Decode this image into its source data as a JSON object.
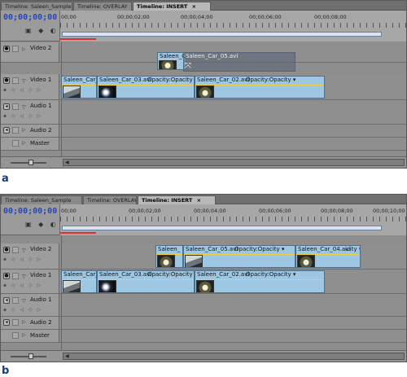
{
  "panels": [
    {
      "label": "a",
      "tabs": [
        "Timeline: Saleen_Sample",
        "Timeline: OVERLAY",
        "Timeline: INSERT"
      ],
      "active_tab_close": "×",
      "timecode": "00;00;00;00",
      "ruler_labels": [
        "00;00",
        "00;00;02;00",
        "00;00;04;00",
        "00;00;06;00",
        "00;00;08;00"
      ],
      "tracks": [
        {
          "name": "Video 2",
          "clips": []
        },
        {
          "name": "Video 1",
          "clips": [
            {
              "name": "Saleen_Car_0",
              "opacity": ""
            },
            {
              "name": "Saleen_Car_03.avi",
              "opacity": "Opacity:Opacity ▾"
            },
            {
              "name": "Saleen_Car_02.avi",
              "opacity": "Opacity:Opacity ▾"
            }
          ]
        },
        {
          "name": "Audio 1"
        },
        {
          "name": "Audio 2"
        },
        {
          "name": "Master"
        }
      ],
      "drag_clip": {
        "name": "Saleen_Ca",
        "ghost_name": "Saleen_Car_05.avi"
      }
    },
    {
      "label": "b",
      "tabs": [
        "Timeline: Saleen_Sample",
        "Timeline: OVERLAY",
        "Timeline: INSERT"
      ],
      "active_tab_close": "×",
      "timecode": "00;00;00;00",
      "ruler_labels": [
        "00;00",
        "00;00;02;00",
        "00;00;04;00",
        "00;00;06;00",
        "00;00;08;00",
        "00;00;10;00"
      ],
      "tracks": [
        {
          "name": "Video 2",
          "clips": [
            {
              "name": "Saleen_",
              "opacity": ""
            },
            {
              "name": "Saleen_Car_05.avi",
              "opacity": "Opacity:Opacity ▾"
            },
            {
              "name": "Saleen_Car_04.avi",
              "opacity": "icity ▾"
            }
          ]
        },
        {
          "name": "Video 1",
          "clips": [
            {
              "name": "Saleen_Car_0",
              "opacity": ""
            },
            {
              "name": "Saleen_Car_03.avi",
              "opacity": "Opacity:Opacity ▾"
            },
            {
              "name": "Saleen_Car_02.avi",
              "opacity": "Opacity:Opacity ▾"
            }
          ]
        },
        {
          "name": "Audio 1"
        },
        {
          "name": "Audio 2"
        },
        {
          "name": "Master"
        }
      ]
    }
  ],
  "colors": {
    "panel_bg": "#8d8d8d",
    "clip_fill": "#9ec7e4",
    "timecode": "#2746b8",
    "playhead": "#e13232",
    "opacity_line": "#f0d040"
  },
  "icons": [
    "eye-icon",
    "speaker-icon",
    "lock-icon",
    "expand-triangle-icon",
    "zoom-slider",
    "scroll-arrow-icon",
    "drag-cursor-icon"
  ]
}
